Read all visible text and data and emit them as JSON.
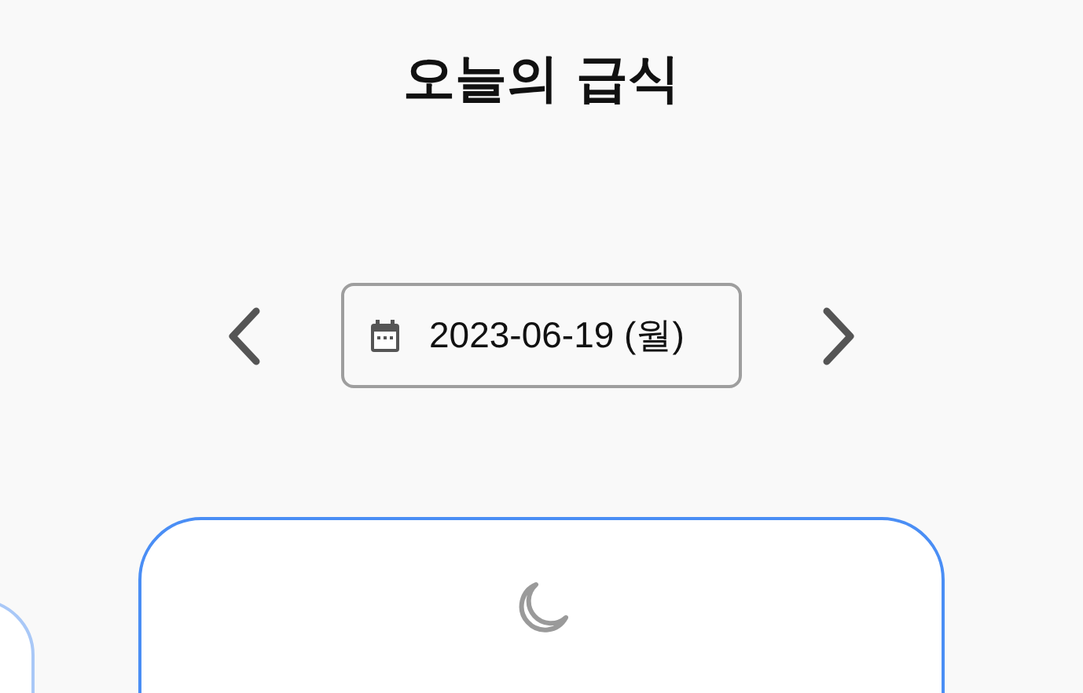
{
  "title": "오늘의 급식",
  "date_picker": {
    "value": "2023-06-19 (월)"
  },
  "meal_cards": [
    {
      "selected": false
    },
    {
      "selected": true
    }
  ]
}
